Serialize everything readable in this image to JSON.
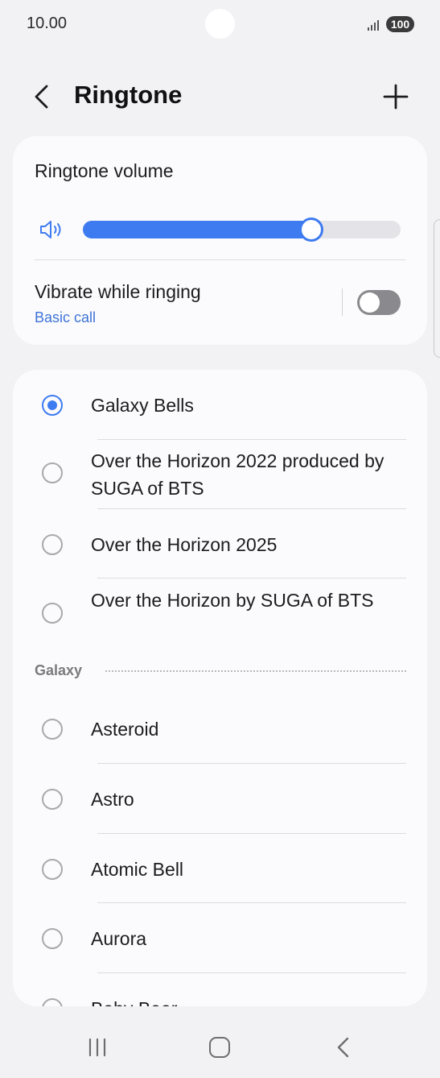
{
  "status_bar": {
    "time": "10.00",
    "battery": "100"
  },
  "header": {
    "title": "Ringtone"
  },
  "volume_card": {
    "volume_label": "Ringtone volume",
    "volume_level": 0.72,
    "vibrate_label": "Vibrate while ringing",
    "vibrate_sublabel": "Basic call",
    "vibrate_on": false
  },
  "ringtones": {
    "top_items": [
      {
        "label": "Galaxy Bells",
        "selected": true
      },
      {
        "label": "Over the Horizon 2022 produced by SUGA of BTS",
        "selected": false
      },
      {
        "label": "Over the Horizon 2025",
        "selected": false
      },
      {
        "label": "Over the Horizon by SUGA of BTS",
        "selected": false
      }
    ],
    "section_title": "Galaxy",
    "galaxy_items": [
      {
        "label": "Asteroid",
        "selected": false
      },
      {
        "label": "Astro",
        "selected": false
      },
      {
        "label": "Atomic Bell",
        "selected": false
      },
      {
        "label": "Aurora",
        "selected": false
      },
      {
        "label": "Baby Bear",
        "selected": false
      }
    ]
  },
  "colors": {
    "accent": "#3e7bf0",
    "link": "#3e73d8",
    "card": "#fbfbfd",
    "background": "#f2f2f5"
  },
  "icons": [
    "back-icon",
    "add-icon",
    "speaker-icon",
    "signal-icon",
    "battery-icon",
    "recents-icon",
    "home-icon",
    "nav-back-icon"
  ]
}
